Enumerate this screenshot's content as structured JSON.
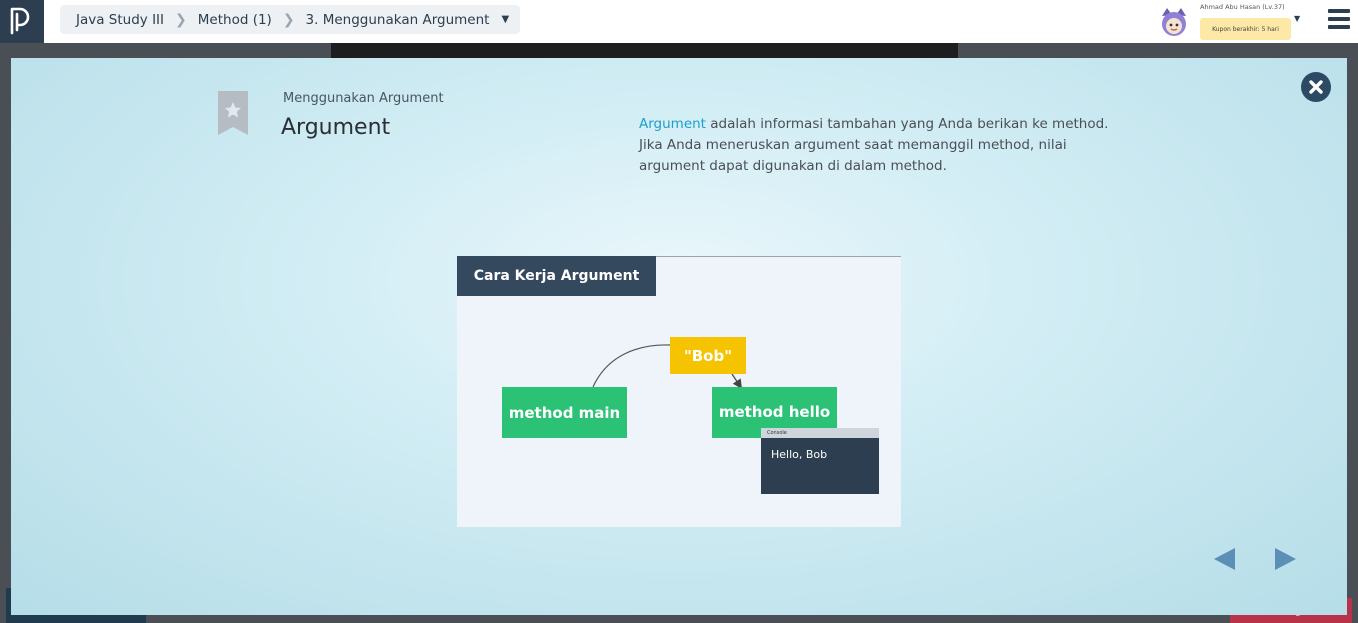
{
  "breadcrumb": {
    "items": [
      "Java Study III",
      "Method (1)",
      "3. Menggunakan Argument"
    ]
  },
  "user": {
    "name": "Ahmad Abu Hasan (Lv.37)",
    "coupon": "Kupon berakhir: 5 hari"
  },
  "background": {
    "bottom_right_label": "Hubungi kami"
  },
  "lesson": {
    "subtitle": "Menggunakan Argument",
    "title": "Argument",
    "desc_keyword": "Argument",
    "desc_rest": " adalah informasi tambahan yang Anda berikan ke method. Jika Anda meneruskan argument saat memanggil method, nilai argument dapat digunakan di dalam method."
  },
  "slide": {
    "header": "Cara Kerja Argument",
    "method_main": "method main",
    "method_hello": "method hello",
    "value": "\"Bob\"",
    "console_title": "Console",
    "console_output": "Hello, Bob"
  },
  "colors": {
    "accent": "#1aa0c8",
    "dark": "#2c3e50",
    "green": "#2bc275",
    "yellow": "#f5c300"
  },
  "icons": [
    "logo-icon",
    "chevron-right-icon",
    "caret-down-icon",
    "avatar-icon",
    "hamburger-icon",
    "bookmark-star-icon",
    "close-icon",
    "arrow-left-icon",
    "arrow-right-icon"
  ]
}
